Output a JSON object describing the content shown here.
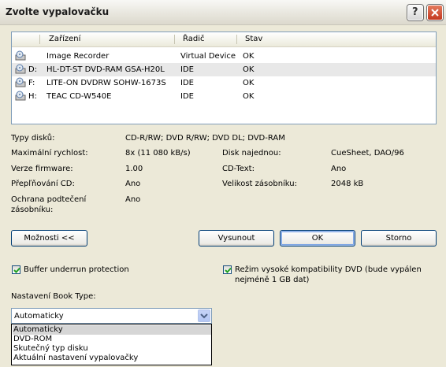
{
  "window": {
    "title": "Zvolte vypalovačku"
  },
  "list": {
    "headers": [
      "Zařízení",
      "Řadič",
      "Stav"
    ],
    "rows": [
      {
        "letter": "",
        "name": "Image Recorder",
        "controller": "Virtual Device",
        "status": "OK",
        "icon": "drive-icon"
      },
      {
        "letter": "D:",
        "name": "HL-DT-ST DVD-RAM GSA-H20L",
        "controller": "IDE",
        "status": "OK",
        "icon": "drive-icon"
      },
      {
        "letter": "F:",
        "name": "LITE-ON DVDRW SOHW-1673S",
        "controller": "IDE",
        "status": "OK",
        "icon": "drive-icon"
      },
      {
        "letter": "H:",
        "name": "TEAC CD-W540E",
        "controller": "IDE",
        "status": "OK",
        "icon": "drive-icon"
      }
    ]
  },
  "info": {
    "disc_types_label": "Typy disků:",
    "disc_types_value": "CD-R/RW; DVD R/RW; DVD DL; DVD-RAM",
    "max_speed_label": "Maximální rychlost:",
    "max_speed_value": "8x (11 080 kB/s)",
    "disc_at_once_label": "Disk najednou:",
    "disc_at_once_value": "CueSheet, DAO/96",
    "firmware_label": "Verze firmware:",
    "firmware_value": "1.00",
    "cdtext_label": "CD-Text:",
    "cdtext_value": "Ano",
    "overburn_label": "Přepľňování CD:",
    "overburn_value": "Ano",
    "buffer_size_label": "Velikost zásobníku:",
    "buffer_size_value": "2048 kB",
    "underrun_label_1": "Ochrana podtečení",
    "underrun_label_2": "zásobníku:",
    "underrun_value": "Ano"
  },
  "buttons": {
    "options": "Možnosti <<",
    "eject": "Vysunout",
    "ok": "OK",
    "cancel": "Storno"
  },
  "options": {
    "buffer_underrun": "Buffer underrun protection",
    "dvd_compat_1": "Režim vysoké kompatibility DVD (bude vypálen",
    "dvd_compat_2": "nejméně 1 GB dat)",
    "book_type_label": "Nastavení Book Type:",
    "book_type_selected": "Automaticky",
    "book_type_options": [
      "Automaticky",
      "DVD-ROM",
      "Skutečný typ disku",
      "Aktuální nastavení vypalovačky"
    ]
  },
  "colors": {
    "selection_border": "#003c74",
    "close_button": "#c4381f"
  }
}
